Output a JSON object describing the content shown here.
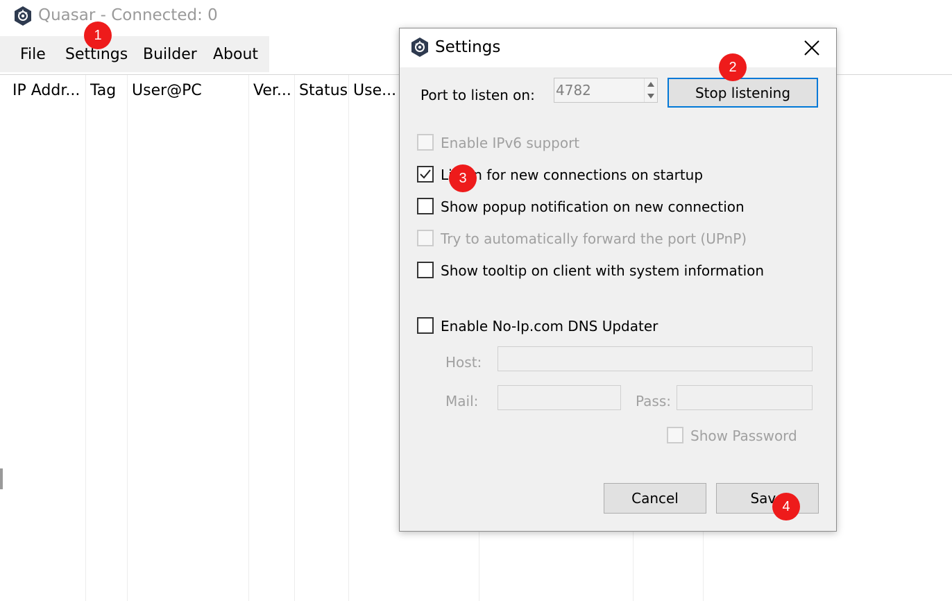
{
  "window": {
    "title": "Quasar - Connected: 0"
  },
  "menu": {
    "items": [
      "File",
      "Settings",
      "Builder",
      "About"
    ]
  },
  "table": {
    "columns": [
      "IP Addr...",
      "Tag",
      "User@PC",
      "Ver...",
      "Status",
      "Use..."
    ]
  },
  "dialog": {
    "title": "Settings",
    "port_label": "Port to listen on:",
    "port_value": "4782",
    "stop_button": "Stop listening",
    "options": [
      {
        "label": "Enable IPv6 support",
        "checked": false,
        "enabled": false
      },
      {
        "label": "Listen for new connections on startup",
        "checked": true,
        "enabled": true
      },
      {
        "label": "Show popup notification on new connection",
        "checked": false,
        "enabled": true
      },
      {
        "label": "Try to automatically forward the port (UPnP)",
        "checked": false,
        "enabled": false
      },
      {
        "label": "Show tooltip on client with system information",
        "checked": false,
        "enabled": true
      }
    ],
    "noip": {
      "label": "Enable No-Ip.com DNS Updater",
      "host_label": "Host:",
      "mail_label": "Mail:",
      "pass_label": "Pass:",
      "show_password_label": "Show Password"
    },
    "cancel_button": "Cancel",
    "save_button": "Save"
  },
  "markers": [
    "1",
    "2",
    "3",
    "4"
  ],
  "colors": {
    "accent": "#0078d7",
    "marker": "#ee1b1b",
    "disabled_text": "#a0a0a0"
  }
}
